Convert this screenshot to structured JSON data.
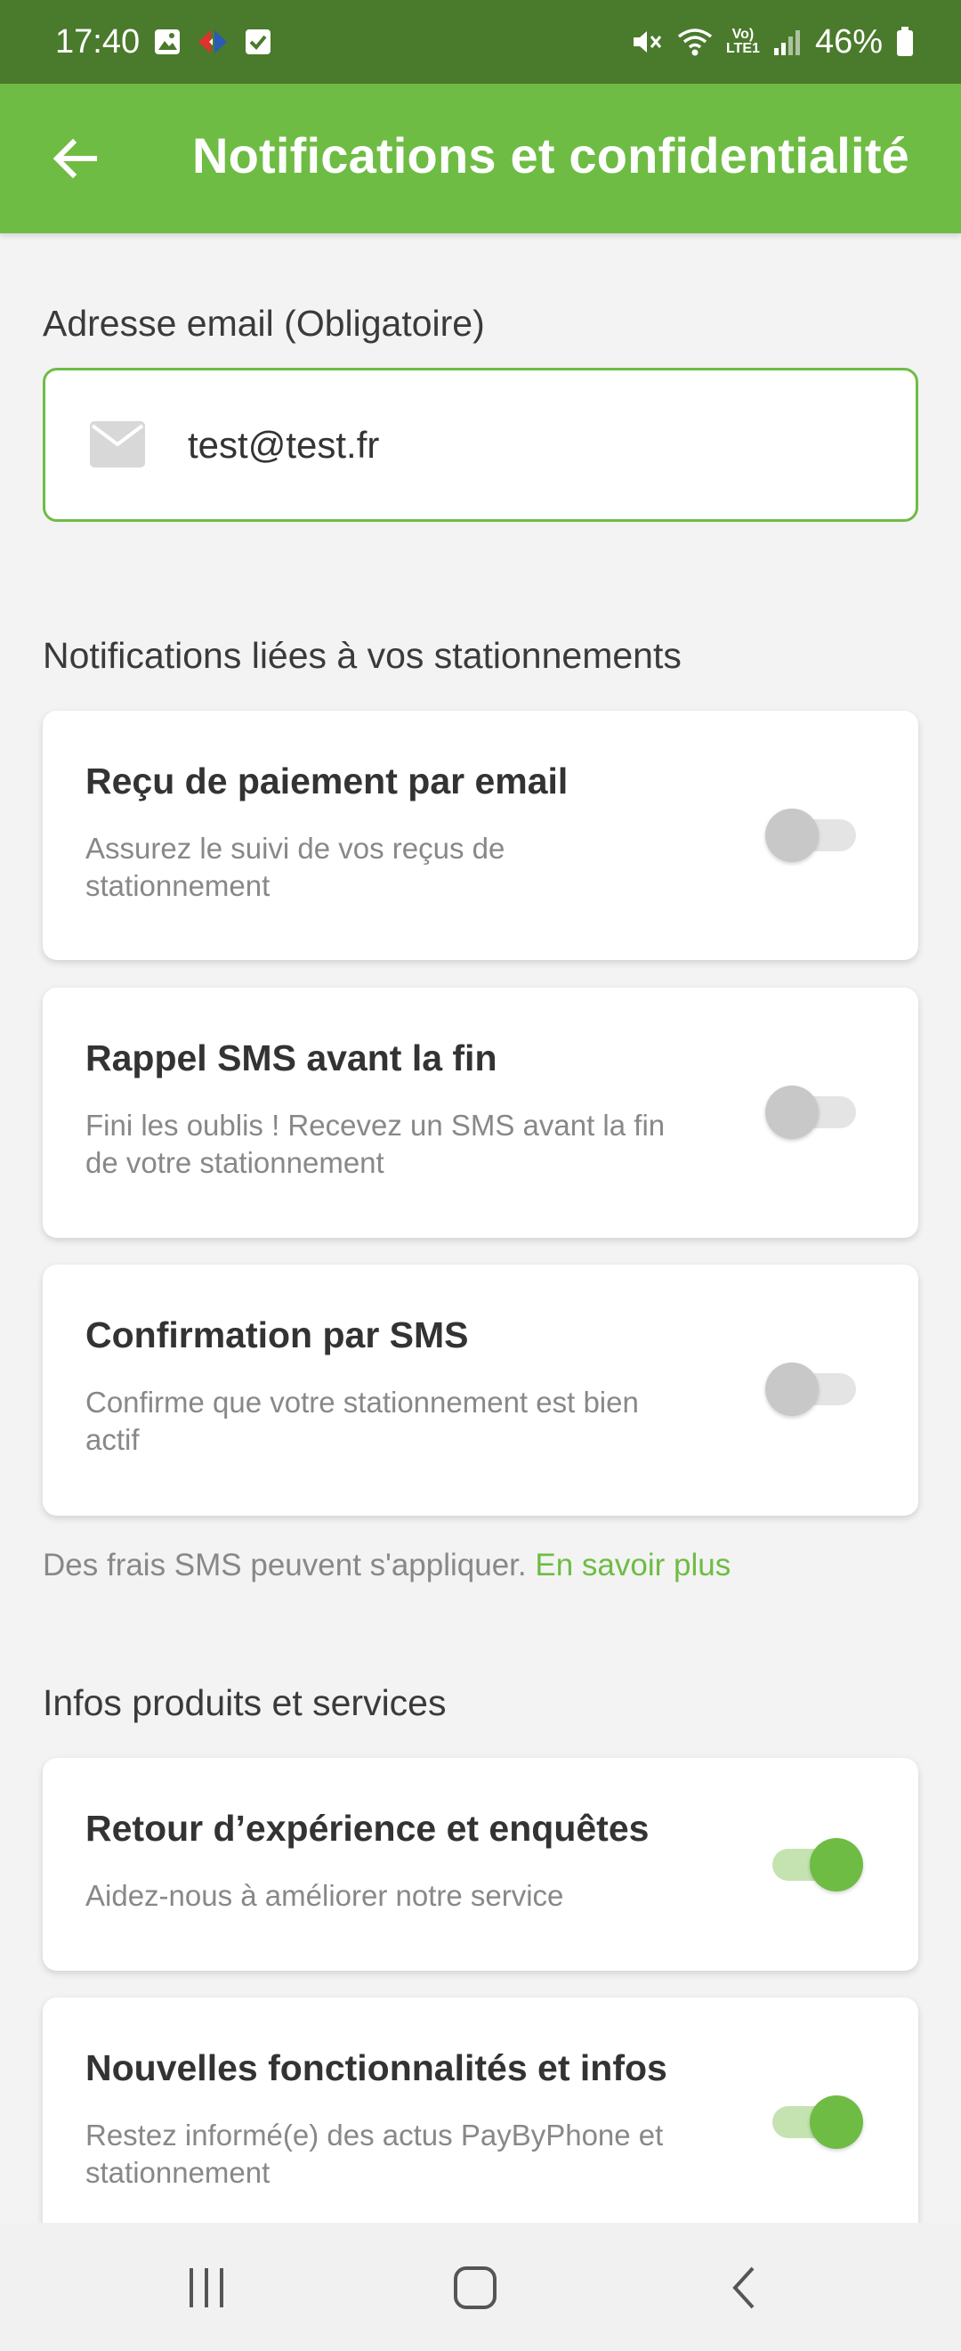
{
  "status_bar": {
    "time": "17:40",
    "battery": "46%",
    "icons": [
      "gallery-icon",
      "carrefour-icon",
      "checkbox-icon",
      "mute-icon",
      "wifi-icon",
      "volte-icon",
      "signal-icon",
      "battery-icon"
    ],
    "network_label_top": "Vo)",
    "network_label_bottom": "LTE1"
  },
  "app_bar": {
    "back_icon": "arrow-left-icon",
    "title": "Notifications et confidentialité"
  },
  "email": {
    "label": "Adresse email (Obligatoire)",
    "value": "test@test.fr",
    "icon": "mail-icon"
  },
  "parking_notifications": {
    "title": "Notifications liées à vos stationnements",
    "items": [
      {
        "title": "Reçu de paiement par email",
        "desc_line1": "Assurez le suivi de vos reçus de",
        "desc_line2": "stationnement",
        "enabled": false
      },
      {
        "title": "Rappel SMS avant la fin",
        "desc_line1": "Fini les oublis ! Recevez un SMS avant la fin",
        "desc_line2": "de votre stationnement",
        "enabled": false
      },
      {
        "title": "Confirmation par SMS",
        "desc_line1": "Confirme que votre stationnement est bien",
        "desc_line2": "actif",
        "enabled": false
      }
    ],
    "sms_note": "Des frais SMS peuvent s'appliquer.",
    "sms_link": "En savoir plus"
  },
  "product_info": {
    "title": "Infos produits et services",
    "items": [
      {
        "title": "Retour d’expérience et enquêtes",
        "desc_line1": "Aidez-nous à améliorer notre service",
        "enabled": true
      },
      {
        "title": "Nouvelles fonctionnalités et infos",
        "desc_line1": "Restez informé(e) des actus PayByPhone et",
        "desc_line2": "stationnement",
        "enabled": true
      }
    ]
  },
  "nav_bar": {
    "icons": [
      "recent-apps-icon",
      "home-icon",
      "back-icon"
    ]
  },
  "colors": {
    "accent": "#6ebc44",
    "status_bar": "#4a7a2c",
    "background": "#f3f3f3"
  }
}
